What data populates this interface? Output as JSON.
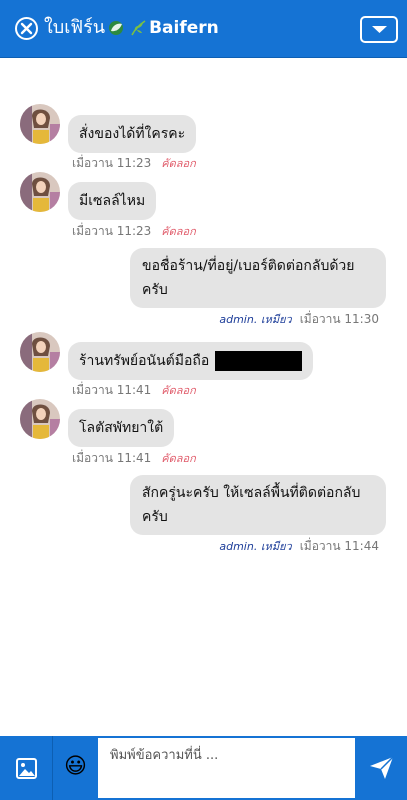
{
  "header": {
    "title_thai": "ใบเฟิร์น",
    "title_brand": "Baifern",
    "close_icon": "close-circle-icon",
    "menu_icon": "chevron-down-icon",
    "accent": "#1573d4"
  },
  "messages": [
    {
      "side": "in",
      "text": "สั่งของได้ที่ใครคะ",
      "time": "เมื่อวาน 11:23",
      "action": "คัดลอก"
    },
    {
      "side": "in",
      "text": "มีเซลล์ไหม",
      "time": "เมื่อวาน 11:23",
      "action": "คัดลอก"
    },
    {
      "side": "out",
      "text": "ขอชื่อร้าน/ที่อยู่/เบอร์ติดต่อกลับด้วยครับ",
      "sender": "admin. เหมียว",
      "time": "เมื่อวาน 11:30"
    },
    {
      "side": "in",
      "text": "ร้านทรัพย์อนันต์มือถือ",
      "time": "เมื่อวาน 11:41",
      "action": "คัดลอก"
    },
    {
      "side": "in",
      "text": "โลตัสพัทยาใต้",
      "time": "เมื่อวาน 11:41",
      "action": "คัดลอก"
    },
    {
      "side": "out",
      "text": "สักครู่นะครับ ให้เซลล์พื้นที่ติดต่อกลับครับ",
      "sender": "admin. เหมียว",
      "time": "เมื่อวาน 11:44"
    }
  ],
  "composer": {
    "placeholder": "พิมพ์ข้อความที่นี่ ...",
    "image_icon": "image-icon",
    "emoji": "😃",
    "send_icon": "send-icon"
  }
}
